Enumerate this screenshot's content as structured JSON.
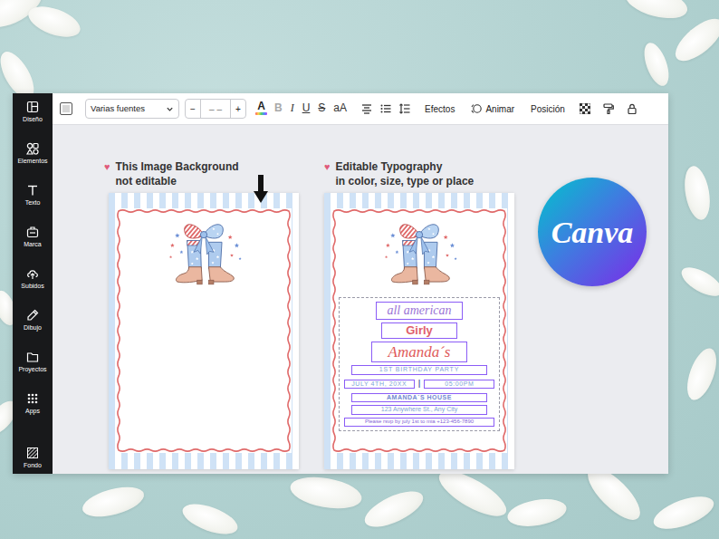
{
  "sidebar": {
    "items": [
      {
        "label": "Diseño"
      },
      {
        "label": "Elementos"
      },
      {
        "label": "Texto"
      },
      {
        "label": "Marca"
      },
      {
        "label": "Subidos"
      },
      {
        "label": "Dibujo"
      },
      {
        "label": "Proyectos"
      },
      {
        "label": "Apps"
      },
      {
        "label": "Fondo"
      }
    ]
  },
  "toolbar": {
    "font": "Varias fuentes",
    "size_minus": "−",
    "size": "– –",
    "size_plus": "+",
    "format": [
      "A",
      "B",
      "I",
      "U",
      "S",
      "aA"
    ],
    "effects": "Efectos",
    "animate": "Animar",
    "position": "Posición"
  },
  "notes": [
    {
      "icon": "♥",
      "lines": [
        "This Image Background",
        "not editable"
      ]
    },
    {
      "icon": "♥",
      "lines": [
        "Editable Typography",
        "in color, size, type or place"
      ]
    }
  ],
  "cards": [
    {
      "kind": "background"
    },
    {
      "kind": "editable",
      "texts": [
        {
          "kind": "script",
          "text": "all american"
        },
        {
          "kind": "bold",
          "text": "Girly"
        },
        {
          "kind": "name",
          "text": "Amanda´s"
        },
        {
          "kind": "caps",
          "text": "1ST BIRTHDAY PARTY"
        },
        {
          "kind": "date-row",
          "parts": [
            "JULY 4TH, 20XX",
            "|",
            "05:00PM"
          ]
        },
        {
          "kind": "house",
          "text": "AMANDA´S HOUSE"
        },
        {
          "kind": "address",
          "text": "123 Anywhere St., Any City"
        },
        {
          "kind": "rsvp",
          "text": "Please rsvp by july 1st to mia +123-456-7890"
        }
      ]
    }
  ],
  "logo": {
    "text": "Canva"
  }
}
